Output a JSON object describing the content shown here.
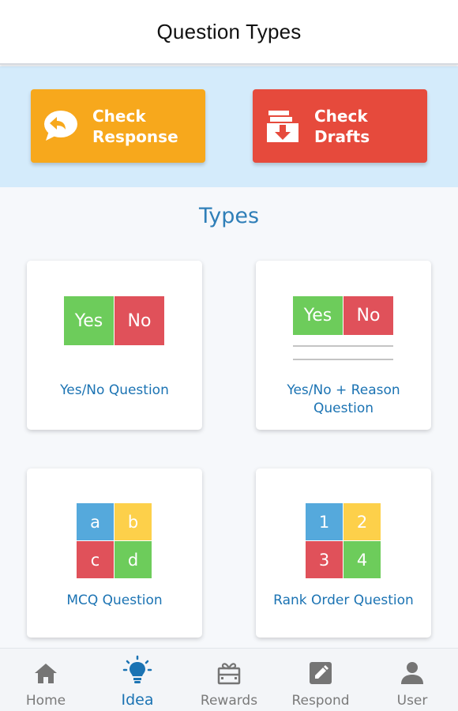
{
  "header": {
    "title": "Question Types"
  },
  "actions": {
    "response": {
      "line1": "Check",
      "line2": "Response",
      "color": "#f7a81c",
      "icon": "chat-reply-icon"
    },
    "drafts": {
      "label": "Check Drafts",
      "color": "#e64a3c",
      "icon": "drafts-download-icon"
    }
  },
  "section": {
    "title": "Types"
  },
  "cards": [
    {
      "label": "Yes/No Question",
      "tiles": [
        "Yes",
        "No"
      ]
    },
    {
      "label_line1": "Yes/No + Reason",
      "label_line2": "Question",
      "tiles": [
        "Yes",
        "No"
      ]
    },
    {
      "label": "MCQ Question",
      "tiles": [
        "a",
        "b",
        "c",
        "d"
      ]
    },
    {
      "label": "Rank Order Question",
      "tiles": [
        "1",
        "2",
        "3",
        "4"
      ]
    }
  ],
  "colors": {
    "green": "#6dcc5b",
    "red": "#e0515a",
    "blue": "#55a9dc",
    "yellow": "#fdd04a",
    "accent": "#1b73b3"
  },
  "bottom_nav": {
    "items": [
      {
        "label": "Home",
        "icon": "home-icon"
      },
      {
        "label": "Idea",
        "icon": "lightbulb-icon",
        "active": true
      },
      {
        "label": "Rewards",
        "icon": "gift-icon"
      },
      {
        "label": "Respond",
        "icon": "edit-icon"
      },
      {
        "label": "User",
        "icon": "user-icon"
      }
    ]
  }
}
